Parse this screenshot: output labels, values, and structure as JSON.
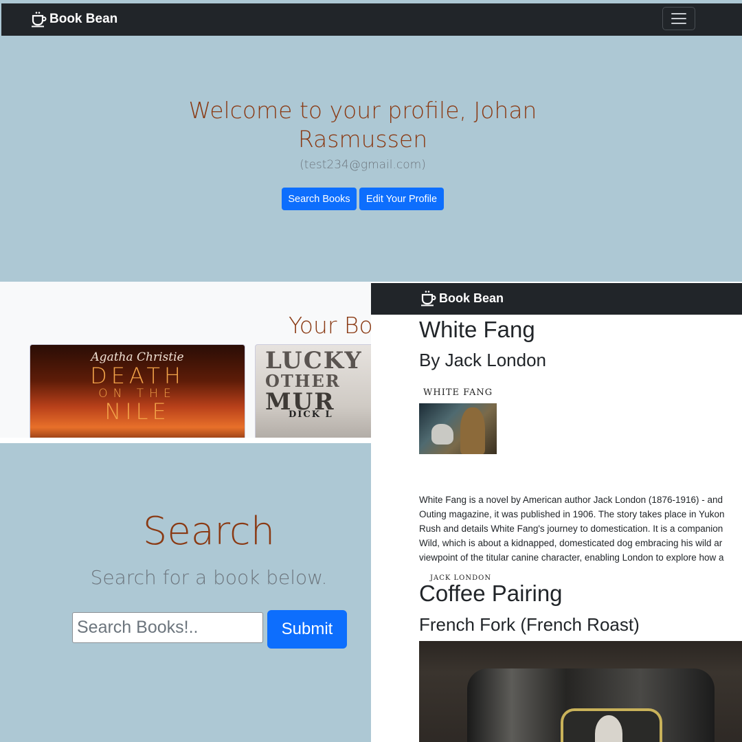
{
  "app": {
    "brand": "Book Bean"
  },
  "profile": {
    "welcome_line1": "Welcome to your profile, Johan",
    "welcome_line2": "Rasmussen",
    "email": "(test234@gmail.com)",
    "buttons": {
      "search": "Search Books",
      "edit": "Edit Your Profile"
    },
    "books_heading": "Your Boo",
    "books": [
      {
        "author": "Agatha Christie",
        "title_lines": [
          "DEATH",
          "ON THE",
          "NILE"
        ]
      },
      {
        "title_lines": [
          "LUCKY",
          "OTHER",
          "MUR"
        ],
        "author": "DICK L"
      }
    ]
  },
  "search": {
    "title": "Search",
    "subtitle": "Search for a book below.",
    "placeholder": "Search Books!..",
    "submit": "Submit"
  },
  "book_detail": {
    "title": "White Fang",
    "author": "By Jack London",
    "cover": {
      "title": "WHITE FANG",
      "author": "JACK LONDON"
    },
    "description_lines": [
      "White Fang is a novel by American author Jack London (1876-1916) - and",
      "Outing magazine, it was published in 1906. The story takes place in Yukon",
      "Rush and details White Fang's journey to domestication. It is a companion",
      "Wild, which is about a kidnapped, domesticated dog embracing his wild ar",
      "viewpoint of the titular canine character, enabling London to explore how a"
    ],
    "coffee_heading": "Coffee Pairing",
    "coffee_name": "French Fork (French Roast)"
  },
  "colors": {
    "navbar": "#212529",
    "hero_bg": "#adc8d4",
    "heading_brown": "#8a3a14",
    "primary_button": "#0d6efd",
    "light_bg": "#f8f9fa"
  }
}
